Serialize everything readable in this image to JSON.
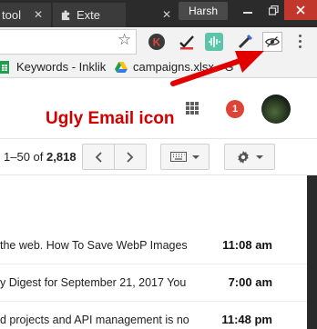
{
  "browser": {
    "tabs": [
      {
        "label": "tool"
      },
      {
        "label": "Exte"
      }
    ],
    "profile_name": "Harsh"
  },
  "bookmarks": [
    {
      "label": "Keywords - Inklik"
    },
    {
      "label": "campaigns.xlsx - G"
    }
  ],
  "gmail": {
    "notification_count": "1",
    "pagination": {
      "range": "1–50",
      "of": "of",
      "total": "2,818"
    }
  },
  "emails": [
    {
      "snippet": "the web. How To Save WebP Images",
      "time": "11:08 am"
    },
    {
      "snippet": "y Digest for September 21, 2017 You",
      "time": "7:00 am"
    },
    {
      "snippet": "d projects and API management is no",
      "time": "11:48 pm"
    }
  ],
  "annotation": {
    "label": "Ugly Email icon",
    "color": "#d10000"
  },
  "colors": {
    "titlebar": "#2b2b2b",
    "close": "#c2372b",
    "badge": "#db4437"
  }
}
